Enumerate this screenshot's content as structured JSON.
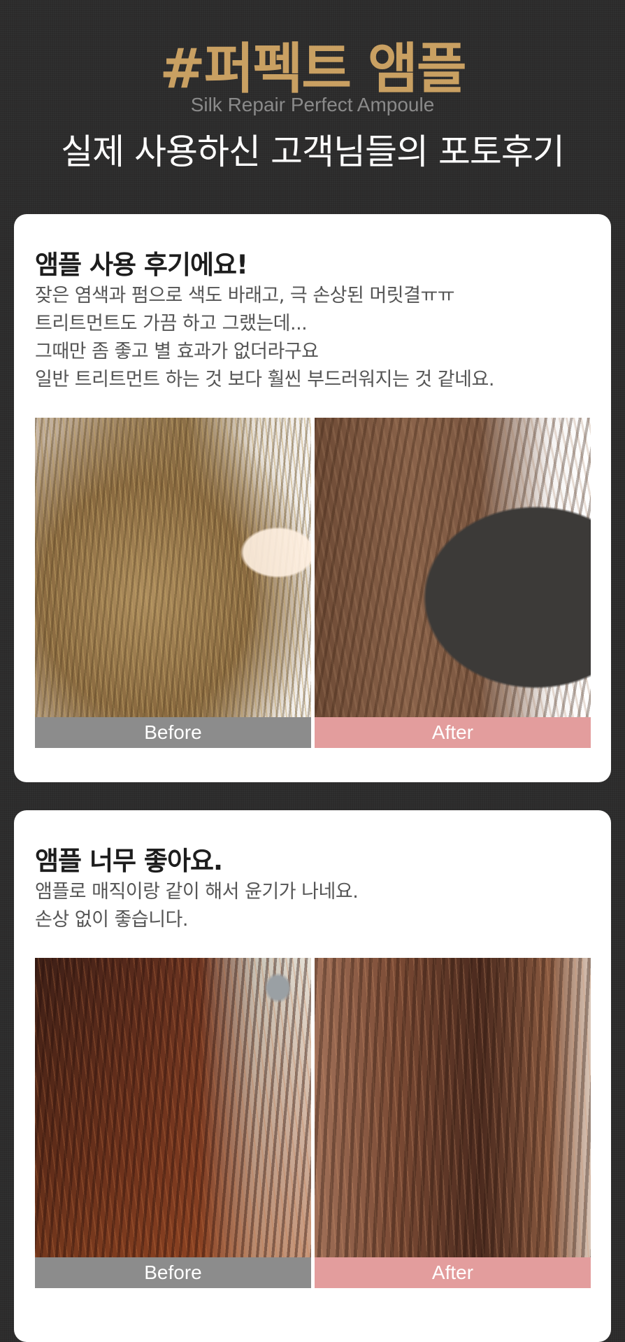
{
  "header": {
    "title": "#퍼펙트 앰플",
    "subtitle_en": "Silk Repair Perfect Ampoule",
    "heading": "실제 사용하신 고객님들의 포토후기"
  },
  "reviews": [
    {
      "title": "앰플 사용 후기에요!",
      "lines": [
        "잦은 염색과 펌으로 색도 바래고, 극 손상된 머릿결ㅠㅠ",
        "트리트먼트도 가끔 하고 그랬는데...",
        "그때만 좀 좋고 별 효과가 없더라구요",
        "일반 트리트먼트 하는 것 보다 훨씬 부드러워지는 것 같네요."
      ],
      "before_label": "Before",
      "after_label": "After"
    },
    {
      "title": "앰플 너무 좋아요.",
      "lines": [
        "앰플로 매직이랑 같이 해서 윤기가 나네요.",
        "손상 없이 좋습니다."
      ],
      "before_label": "Before",
      "after_label": "After"
    }
  ],
  "colors": {
    "title_gold": "#c9a062",
    "before_label_bg": "#8c8c8c",
    "after_label_bg": "#e39d9d",
    "background": "#2b2a2a"
  }
}
